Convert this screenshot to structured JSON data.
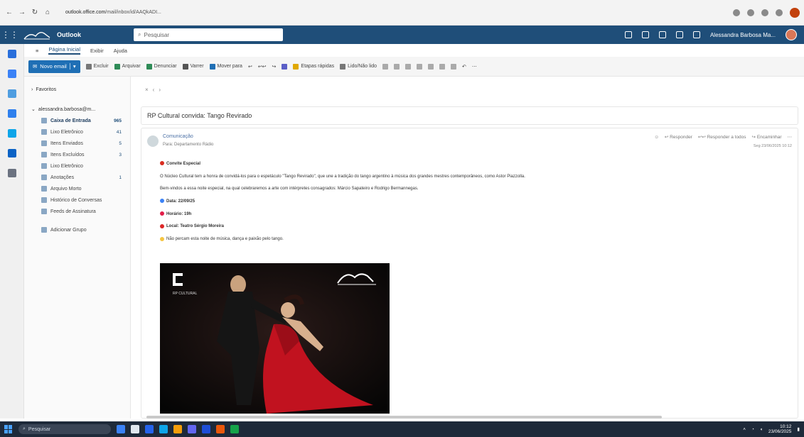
{
  "browser": {
    "url_host": "outlook.office.com",
    "url_path": "/mail/inbox/id/AAQkADI..."
  },
  "header": {
    "app_name": "Outlook",
    "search_placeholder": "Pesquisar",
    "user_name": "Alessandra Barbosa Ma..."
  },
  "ribbon": {
    "tabs": [
      "Página Inicial",
      "Exibir",
      "Ajuda"
    ],
    "active_tab": "Página Inicial",
    "new_mail": "Novo email",
    "buttons": [
      "Excluir",
      "Arquivar",
      "Denunciar",
      "Varrer",
      "Mover para",
      "Etapas rápidas",
      "Lido/Não lido"
    ]
  },
  "folders": {
    "favorites": "Favoritos",
    "account": "alessandra.barbosa@m...",
    "items": [
      {
        "label": "Caixa de Entrada",
        "count": "965",
        "selected": true
      },
      {
        "label": "Lixo Eletrônico",
        "count": "41"
      },
      {
        "label": "Itens Enviados",
        "count": "5"
      },
      {
        "label": "Itens Excluídos",
        "count": "3"
      },
      {
        "label": "Lixo Eletrônico",
        "count": ""
      },
      {
        "label": "Anotações",
        "count": "1"
      },
      {
        "label": "Arquivo Morto",
        "count": ""
      },
      {
        "label": "Histórico de Conversas",
        "count": ""
      },
      {
        "label": "Feeds de Assinatura",
        "count": ""
      }
    ],
    "add_group": "Adicionar Grupo"
  },
  "message": {
    "subject": "RP Cultural convida: Tango Revirado",
    "sender": "Comunicação",
    "to": "Para: Departamento Rádio",
    "actions": [
      "Responder",
      "Responder a todos",
      "Encaminhar"
    ],
    "date": "Seg 23/06/2025 10:12",
    "body": {
      "heading": "Convite Especial",
      "para1": "O Núcleo Cultural tem a honra de convidá-los para o espetáculo \"Tango Revirado\", que une a tradição do tango argentino à música dos grandes mestres contemporâneos, como Astor Piazzolla.",
      "para2": "Bem-vindos a essa noite especial, na qual celebraremos a arte com intérpretes consagrados: Márcio Sapateiro e Rodrigo Bermannegas.",
      "date_line": "Data: 22/09/25",
      "time_line": "Horário: 19h",
      "place_line": "Local: Teatro Sérgio Moreira",
      "closing": "Não percam esta noite de música, dança e paixão pelo tango."
    },
    "image_caption": "RP CULTURAL"
  },
  "taskbar": {
    "search": "Pesquisar",
    "time": "10:12",
    "date": "23/06/2025"
  }
}
